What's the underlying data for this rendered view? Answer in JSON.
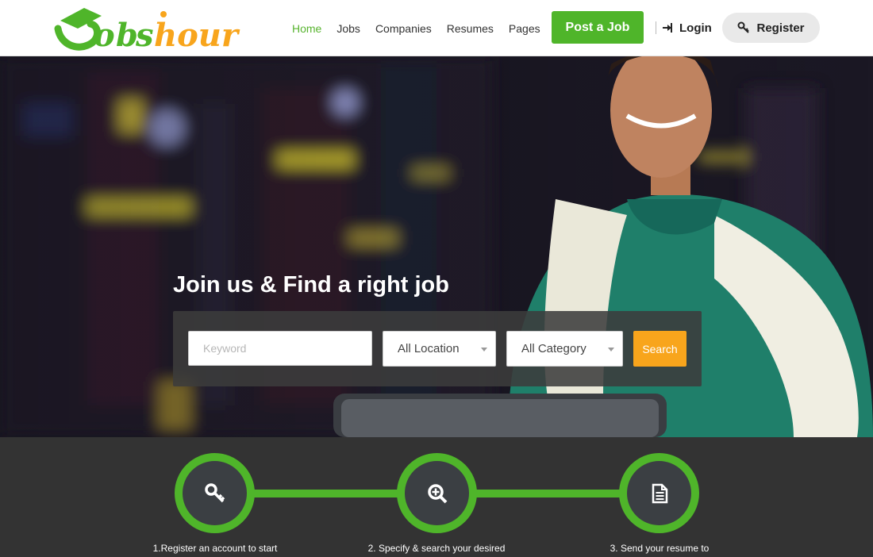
{
  "brand": {
    "logo_text": "Jobshour",
    "colors": {
      "green": "#4fb52a",
      "orange": "#f8a51c",
      "dark": "#333333"
    }
  },
  "nav": {
    "items": [
      "Home",
      "Jobs",
      "Companies",
      "Resumes",
      "Pages"
    ],
    "active": "Home"
  },
  "header": {
    "post_label": "Post a Job",
    "login_label": "Login",
    "register_label": "Register",
    "login_icon": "sign-in-icon",
    "register_icon": "key-icon"
  },
  "hero": {
    "title": "Join us & Find a right job"
  },
  "search": {
    "keyword_placeholder": "Keyword",
    "keyword_value": "",
    "location_selected": "All Location",
    "category_selected": "All Category",
    "button_label": "Search"
  },
  "steps": [
    {
      "icon": "key-icon",
      "label": "1.Register an account to start"
    },
    {
      "icon": "search-plus-icon",
      "label": "2. Specify & search your desired"
    },
    {
      "icon": "document-icon",
      "label": "3. Send your resume to"
    }
  ]
}
